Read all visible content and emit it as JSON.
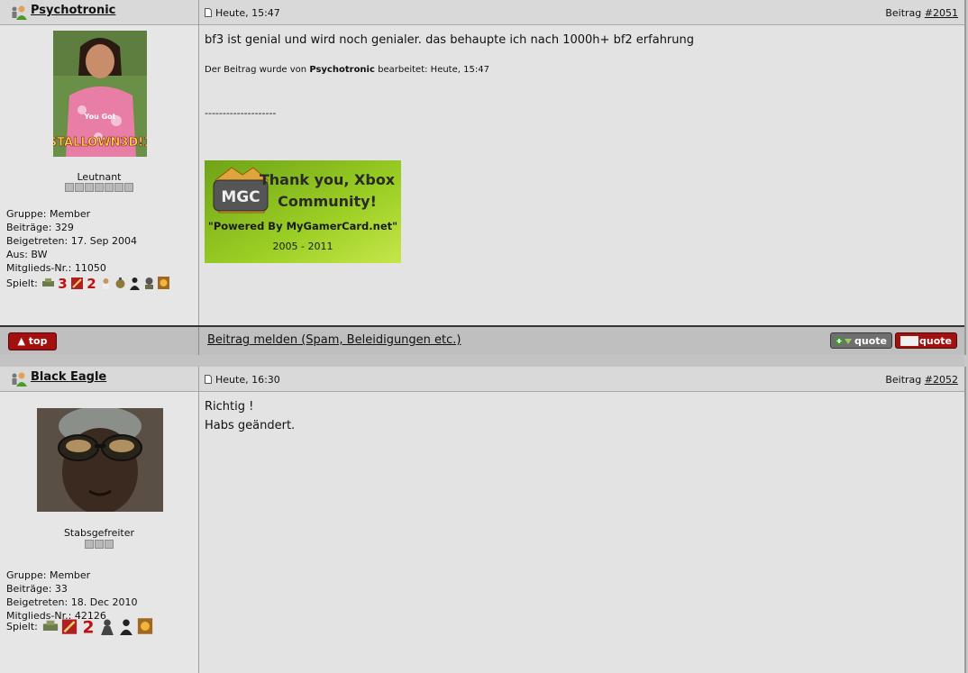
{
  "posts": [
    {
      "username": "Psychotronic",
      "time": "Heute, 15:47",
      "post_label": "Beitrag",
      "post_number": "#2051",
      "avatar_text_top": "You Got",
      "avatar_text_bottom": "STALLOWN3D!1",
      "rank": "Leutnant",
      "rank_pips": 7,
      "group": "Gruppe: Member",
      "posts_count": "Beiträge: 329",
      "joined": "Beigetreten: 17. Sep 2004",
      "from": "Aus: BW",
      "member_no": "Mitglieds-Nr.: 11050",
      "plays_label": "Spielt:",
      "message": "bf3 ist genial und wird noch genialer. das behaupte ich nach 1000h+ bf2 erfahrung",
      "edit_prefix": "Der Beitrag wurde von",
      "edit_user": "Psychotronic",
      "edit_suffix": "bearbeitet: Heute, 15:47",
      "signature_line": "--------------------",
      "banner": {
        "logo": "MGC",
        "line1": "Thank you, Xbox",
        "line2": "Community!",
        "line3": "\"Powered By MyGamerCard.net\"",
        "line4": "2005 - 2011"
      }
    },
    {
      "username": "Black Eagle",
      "time": "Heute, 16:30",
      "post_label": "Beitrag",
      "post_number": "#2052",
      "rank": "Stabsgefreiter",
      "rank_pips": 3,
      "group": "Gruppe: Member",
      "posts_count": "Beiträge: 33",
      "joined": "Beigetreten: 18. Dec 2010",
      "member_no": "Mitglieds-Nr.: 42126",
      "plays_label": "Spielt:",
      "message_line1": "Richtig !",
      "message_line2": "Habs geändert."
    }
  ],
  "actions": {
    "top_label": "top",
    "report_label": "Beitrag melden (Spam, Beleidigungen etc.)",
    "quote_label": "quote"
  },
  "colors": {
    "button_red": "#a31010",
    "button_gray": "#6f6f6f",
    "banner_green": "#8fc21a"
  },
  "icons": {
    "user": "user-online-icon",
    "post": "post-document-icon"
  }
}
